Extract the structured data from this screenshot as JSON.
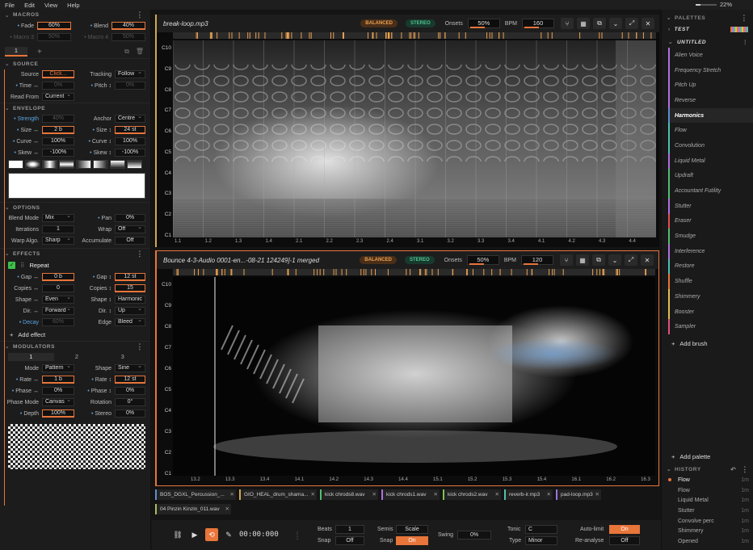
{
  "menu": [
    "File",
    "Edit",
    "View",
    "Help"
  ],
  "zoom": "22%",
  "left": {
    "macros": {
      "title": "MACROS",
      "fade_label": "Fade",
      "fade": "60%",
      "blend_label": "Blend",
      "blend": "40%",
      "macro3_label": "Macro 3",
      "macro3": "50%",
      "macro4_label": "Macro 4",
      "macro4": "50%"
    },
    "layer_tab": "1",
    "source": {
      "title": "SOURCE",
      "source_label": "Source",
      "source": "Click...",
      "tracking_label": "Tracking",
      "tracking": "Follow",
      "time_label": "Time ↔",
      "time": "0%",
      "pitch_label": "Pitch ↕",
      "pitch": "0%",
      "readfrom_label": "Read From",
      "readfrom": "Current"
    },
    "envelope": {
      "title": "ENVELOPE",
      "strength_label": "Strength",
      "strength": "40%",
      "anchor_label": "Anchor",
      "anchor": "Centre",
      "sizex_label": "Size ↔",
      "sizex": "2 b",
      "sizey_label": "Size ↕",
      "sizey": "24 st",
      "curvex_label": "Curve ↔",
      "curvex": "100%",
      "curvey_label": "Curve ↕",
      "curvey": "100%",
      "skewx_label": "Skew ↔",
      "skewx": "-100%",
      "skewy_label": "Skew ↕",
      "skewy": "-100%"
    },
    "options": {
      "title": "OPTIONS",
      "blendmode_label": "Blend Mode",
      "blendmode": "Mix",
      "pan_label": "Pan",
      "pan": "0%",
      "iterations_label": "Iterations",
      "iterations": "1",
      "wrap_label": "Wrap",
      "wrap": "Off",
      "warp_label": "Warp Algo.",
      "warp": "Sharp",
      "accumulate_label": "Accumulate",
      "accumulate": "Off"
    },
    "effects": {
      "title": "EFFECTS",
      "effect_name": "Repeat",
      "gapx_label": "Gap ↔",
      "gapx": "0 b",
      "gapy_label": "Gap ↕",
      "gapy": "12 st",
      "copiesx_label": "Copies ↔",
      "copiesx": "0",
      "copiesy_label": "Copies ↕",
      "copiesy": "15",
      "shapex_label": "Shape ↔",
      "shapex": "Even",
      "shapey_label": "Shape ↕",
      "shapey": "Harmonic",
      "dirx_label": "Dir. ↔",
      "dirx": "Forward",
      "diry_label": "Dir. ↕",
      "diry": "Up",
      "decay_label": "Decay",
      "decay": "60%",
      "edge_label": "Edge",
      "edge": "Bleed",
      "add_effect": "Add effect"
    },
    "modulators": {
      "title": "MODULATORS",
      "tabs": [
        "1",
        "2",
        "3"
      ],
      "mode_label": "Mode",
      "mode": "Pattern",
      "shape_label": "Shape",
      "shape": "Sine",
      "ratex_label": "Rate ↔",
      "ratex": "1 b",
      "ratey_label": "Rate ↕",
      "ratey": "12 st",
      "phasex_label": "Phase ↔",
      "phasex": "0%",
      "phasey_label": "Phase ↕",
      "phasey": "0%",
      "phasemode_label": "Phase Mode",
      "phasemode": "Canvas",
      "rotation_label": "Rotation",
      "rotation": "0°",
      "depth_label": "Depth",
      "depth": "100%",
      "stereo_label": "Stereo",
      "stereo": "0%"
    }
  },
  "panels": [
    {
      "title": "break-loop.mp3",
      "mode": "BALANCED",
      "channels": "STEREO",
      "onsets_label": "Onsets",
      "onsets": "50%",
      "bpm_label": "BPM",
      "bpm": "160",
      "y_labels": [
        "C10",
        "C9",
        "C8",
        "C7",
        "C6",
        "C5",
        "C4",
        "C3",
        "C2",
        "C1"
      ],
      "x_labels": [
        "1.1",
        "1.2",
        "1.3",
        "1.4",
        "2.1",
        "2.2",
        "2.3",
        "2.4",
        "3.1",
        "3.2",
        "3.3",
        "3.4",
        "4.1",
        "4.2",
        "4.3",
        "4.4"
      ]
    },
    {
      "title": "Bounce 4-3-Audio 0001-en...-08-21 124249]-1 merged",
      "mode": "BALANCED",
      "channels": "STEREO",
      "onsets_label": "Onsets",
      "onsets": "50%",
      "bpm_label": "BPM",
      "bpm": "120",
      "y_labels": [
        "C10",
        "C9",
        "C8",
        "C7",
        "C6",
        "C5",
        "C4",
        "C3",
        "C2",
        "C1"
      ],
      "x_labels": [
        "13.2",
        "13.3",
        "13.4",
        "14.1",
        "14.2",
        "14.3",
        "14.4",
        "15.1",
        "15.2",
        "15.3",
        "15.4",
        "16.1",
        "16.2",
        "16.3"
      ]
    }
  ],
  "files": [
    {
      "name": "BOS_DGXL_Percussion_...",
      "color": "#5b8fd0"
    },
    {
      "name": "GIO_HEAL_drum_shama...",
      "color": "#d0a850"
    },
    {
      "name": "kick chrods8.wav",
      "color": "#50c070"
    },
    {
      "name": "kick chrods1.wav",
      "color": "#b070e0"
    },
    {
      "name": "kick chrods2.wav",
      "color": "#80c050"
    },
    {
      "name": "reverb-ir.mp3",
      "color": "#50c0b0"
    },
    {
      "name": "pad-loop.mp3",
      "color": "#a070e0"
    },
    {
      "name": "04 Pinzin Kinzin_011.wav",
      "color": "#a0c060"
    }
  ],
  "transport": {
    "time": "00:00:000",
    "beats_label": "Beats",
    "beats": "1",
    "snap_label": "Snap",
    "snap1": "Off",
    "semis_label": "Semis",
    "semis": "Scale",
    "snap2": "On",
    "swing_label": "Swing",
    "swing": "0%",
    "tonic_label": "Tonic",
    "tonic": "C",
    "type_label": "Type",
    "type": "Minor",
    "autolimit_label": "Auto-limit",
    "autolimit": "On",
    "reanalyse_label": "Re-analyse",
    "reanalyse": "Off"
  },
  "right": {
    "palettes_title": "PALETTES",
    "palette_test": "TEST",
    "palette_untitled": "UNTITLED",
    "brushes": [
      {
        "name": "Alien Voice",
        "color": "#b070e0"
      },
      {
        "name": "Frequency Stretch",
        "color": "#b070e0"
      },
      {
        "name": "Pitch Up",
        "color": "#b070e0"
      },
      {
        "name": "Reverse",
        "color": "#b070e0"
      },
      {
        "name": "Harmonics",
        "color": "#5b8fd0"
      },
      {
        "name": "Flow",
        "color": "#50c0b0"
      },
      {
        "name": "Convolution",
        "color": "#50c0b0"
      },
      {
        "name": "Liquid Metal",
        "color": "#b070e0"
      },
      {
        "name": "Updraft",
        "color": "#50c070"
      },
      {
        "name": "Accountant Futility",
        "color": "#50c070"
      },
      {
        "name": "Stutter",
        "color": "#b070e0"
      },
      {
        "name": "Eraser",
        "color": "#e05050"
      },
      {
        "name": "Smudge",
        "color": "#50c070"
      },
      {
        "name": "Interference",
        "color": "#b070e0"
      },
      {
        "name": "Restore",
        "color": "#50c0b0"
      },
      {
        "name": "Shuffle",
        "color": "#e8753a"
      },
      {
        "name": "Shimmery",
        "color": "#e0c050"
      },
      {
        "name": "Booster",
        "color": "#e0c050"
      },
      {
        "name": "Sampler",
        "color": "#e05080"
      }
    ],
    "add_brush": "Add brush",
    "add_palette": "Add palette",
    "history_title": "HISTORY",
    "history": [
      {
        "name": "Flow",
        "time": "1m"
      },
      {
        "name": "Flow",
        "time": "1m"
      },
      {
        "name": "Liquid Metal",
        "time": "1m"
      },
      {
        "name": "Stutter",
        "time": "1m"
      },
      {
        "name": "Convolve perc",
        "time": "1m"
      },
      {
        "name": "Shimmery",
        "time": "1m"
      },
      {
        "name": "Opened",
        "time": "1m"
      }
    ]
  },
  "colors": {
    "accent": "#e8753a",
    "blue": "#5ba4e0",
    "green": "#3ec04a"
  }
}
